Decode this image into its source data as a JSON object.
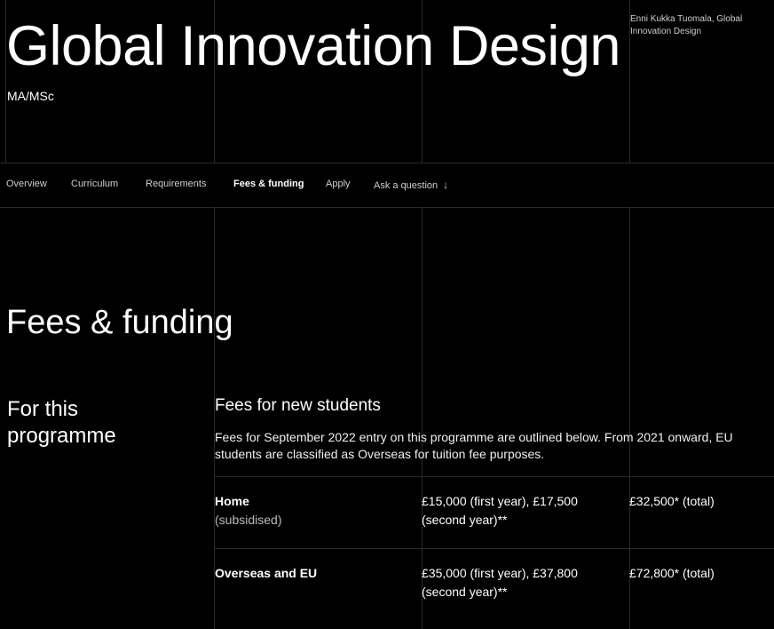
{
  "header": {
    "title": "Global Innovation Design",
    "subtitle": "MA/MSc",
    "image_credit": "Enni Kukka Tuomala, Global Innovation Design"
  },
  "nav": {
    "items": [
      {
        "label": "Overview"
      },
      {
        "label": "Curriculum"
      },
      {
        "label": "Requirements"
      },
      {
        "label": "Fees & funding"
      },
      {
        "label": "Apply"
      },
      {
        "label": "Ask a question"
      }
    ],
    "active": "Fees & funding",
    "ask_icon": "arrow-down-icon"
  },
  "fees": {
    "section_title": "Fees & funding",
    "side_title": "For this programme",
    "heading": "Fees for new students",
    "description": "Fees for September 2022 entry on this programme are outlined below. From 2021 onward, EU students are classified as Overseas for tuition fee purposes.",
    "rows": [
      {
        "category": "Home",
        "note": "(subsidised)",
        "per_year": "£15,000 (first year), £17,500 (second year)**",
        "total": "£32,500* (total)"
      },
      {
        "category": "Overseas and EU",
        "note": "",
        "per_year": "£35,000 (first year), £37,800 (second year)**",
        "total": "£72,800* (total)"
      }
    ]
  },
  "colors": {
    "background": "#000000",
    "text": "#ffffff",
    "gridline": "#2a2a2a"
  }
}
